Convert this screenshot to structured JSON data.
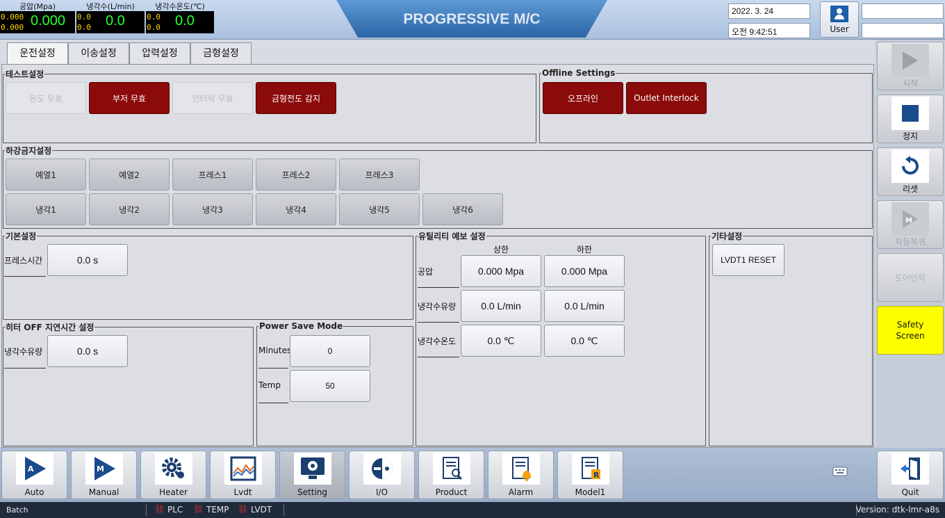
{
  "header": {
    "meters": [
      {
        "label": "공압(Mpa)",
        "small1": "0.000",
        "small2": "0.000",
        "value": "0.000"
      },
      {
        "label": "냉각수(L/min)",
        "small1": "0.0",
        "small2": "0.0",
        "value": "0.0"
      },
      {
        "label": "냉각수온도(℃)",
        "small1": "0.0",
        "small2": "0.0",
        "value": "0.0"
      }
    ],
    "title": "PROGRESSIVE M/C",
    "date": "2022. 3. 24",
    "time": "오전 9:42:51",
    "user_label": "User",
    "field1": "",
    "field2": ""
  },
  "tabs": [
    "운전설정",
    "이송설정",
    "압력설정",
    "금형설정"
  ],
  "test_settings": {
    "legend": "테스트설정",
    "buttons": [
      "온도 무효",
      "부저 무효",
      "인터락 무효",
      "금형전도 감지"
    ]
  },
  "offline_settings": {
    "legend": "Offline Settings",
    "buttons": [
      "오프라인",
      "Outlet Interlock"
    ]
  },
  "descent": {
    "legend": "하강금지설정",
    "row1": [
      "예열1",
      "예열2",
      "프레스1",
      "프레스2",
      "프레스3"
    ],
    "row2": [
      "냉각1",
      "냉각2",
      "냉각3",
      "냉각4",
      "냉각5",
      "냉각6"
    ]
  },
  "basic": {
    "legend": "기본설정",
    "label": "프레스시간",
    "value": "0.0 s"
  },
  "heater_off": {
    "legend": "히터 OFF 지연시간 설정",
    "label": "냉각수유량",
    "value": "0.0 s"
  },
  "power_save": {
    "legend": "Power Save Mode",
    "rows": [
      {
        "label": "Minutes",
        "value": "0"
      },
      {
        "label": "Temp",
        "value": "50"
      }
    ]
  },
  "utility": {
    "legend": "유틸리티 예보 설정",
    "col_upper": "상한",
    "col_lower": "하한",
    "rows": [
      {
        "label": "공압",
        "upper": "0.000 Mpa",
        "lower": "0.000 Mpa"
      },
      {
        "label": "냉각수유량",
        "upper": "0.0 L/min",
        "lower": "0.0 L/min"
      },
      {
        "label": "냉각수온도",
        "upper": "0.0 ℃",
        "lower": "0.0 ℃"
      }
    ]
  },
  "etc": {
    "legend": "기타설정",
    "button": "LVDT1 RESET"
  },
  "right_panel": [
    "시작",
    "정지",
    "리셋",
    "자동복귀",
    "도어언락",
    "Safety Screen"
  ],
  "nav": [
    "Auto",
    "Manual",
    "Heater",
    "Lvdt",
    "Setting",
    "I/O",
    "Product",
    "Alarm",
    "Model1",
    "Quit"
  ],
  "status": {
    "left": "Batch",
    "items": [
      "PLC",
      "TEMP",
      "LVDT"
    ],
    "version": "Version: dtk-lmr-a8s"
  },
  "colors": {
    "accent_red": "#8b0a0a",
    "safety_yellow": "#ffff00",
    "meter_green": "#2aff2a"
  }
}
